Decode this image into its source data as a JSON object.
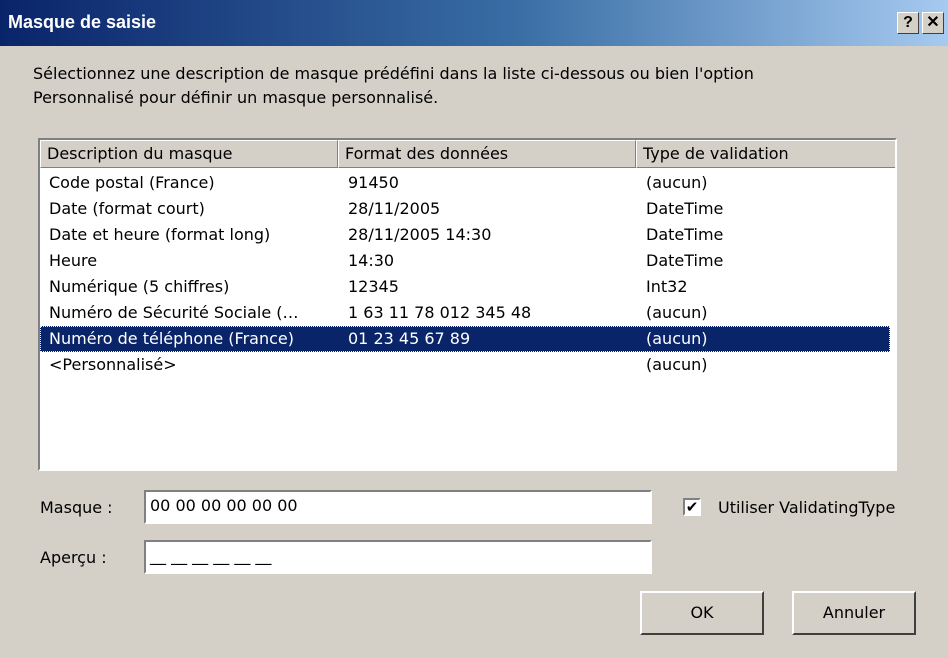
{
  "window": {
    "title": "Masque de saisie",
    "help_glyph": "?",
    "close_glyph": "✕"
  },
  "intro": {
    "line1": "Sélectionnez une description de masque prédéfini dans la liste ci-dessous ou bien l'option",
    "line2": "Personnalisé pour définir un masque personnalisé."
  },
  "list": {
    "columns": [
      "Description du masque",
      "Format des données",
      "Type de validation"
    ],
    "rows": [
      {
        "description": "Code postal (France)",
        "format": "91450",
        "validation": "(aucun)"
      },
      {
        "description": "Date (format court)",
        "format": "28/11/2005",
        "validation": "DateTime"
      },
      {
        "description": "Date et heure (format long)",
        "format": "28/11/2005 14:30",
        "validation": "DateTime"
      },
      {
        "description": "Heure",
        "format": "14:30",
        "validation": "DateTime"
      },
      {
        "description": "Numérique (5 chiffres)",
        "format": "12345",
        "validation": "Int32"
      },
      {
        "description": "Numéro de Sécurité Sociale (…",
        "format": "1 63 11 78 012 345 48",
        "validation": "(aucun)"
      },
      {
        "description": "Numéro de téléphone (France)",
        "format": "01 23 45 67 89",
        "validation": "(aucun)"
      },
      {
        "description": "<Personnalisé>",
        "format": "",
        "validation": "(aucun)"
      }
    ],
    "selected_index": 6
  },
  "masque": {
    "label": "Masque :",
    "value": "00 00 00 00 00 00"
  },
  "apercu": {
    "label": "Aperçu :",
    "value": "__ __ __ __ __ __"
  },
  "validating": {
    "label": "Utiliser ValidatingType",
    "checked": true,
    "check_glyph": "✔"
  },
  "buttons": {
    "ok": "OK",
    "cancel": "Annuler"
  },
  "colors": {
    "face": "#d4d0c8",
    "title_start": "#0a246a",
    "title_end": "#a6caf0",
    "selection": "#0a246a"
  }
}
